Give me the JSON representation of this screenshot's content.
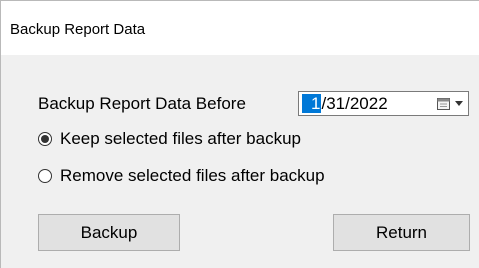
{
  "window": {
    "title": "Backup Report Data"
  },
  "form": {
    "label": "Backup Report Data Before",
    "date": {
      "selected_part": "1",
      "rest": "/31/2022",
      "dropdown_icon": "calendar-dropdown-icon"
    },
    "options": [
      {
        "label": "Keep selected files after backup",
        "checked": true
      },
      {
        "label": "Remove selected files after backup",
        "checked": false
      }
    ]
  },
  "buttons": {
    "backup_label": "Backup",
    "return_label": "Return"
  }
}
